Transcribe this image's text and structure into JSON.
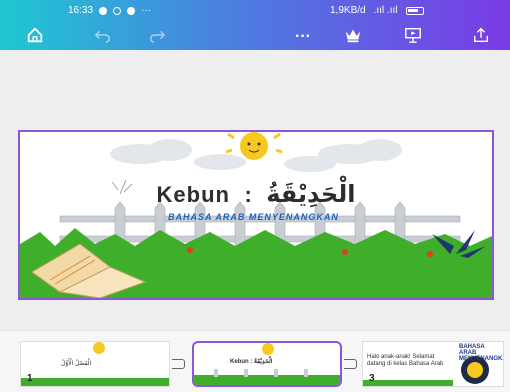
{
  "status_bar": {
    "time": "16:33",
    "speed": "1,9KB/d",
    "carrier": ".ııl .ııl"
  },
  "toolbar": {
    "icons": [
      "home-icon",
      "undo-icon",
      "redo-icon",
      "more-icon",
      "crown-icon",
      "present-icon",
      "share-icon"
    ]
  },
  "slide": {
    "title_latin": "Kebun",
    "separator": ":",
    "title_arabic": "الْحَدِيْقَةُ",
    "banner": "BAHASA ARAB MENYENANGKAN"
  },
  "thumbnails": [
    {
      "number": "1",
      "text": "الْفَصْلُ الْأَوَّلُ"
    },
    {
      "number": "",
      "text": "Kebun : الْحَدِيْقَةُ"
    },
    {
      "number": "3",
      "text": "Halo anak-anak! Selamat datang di kelas Bahasa Arab",
      "badge": "BAHASA ARAB MENYENANGKAN"
    }
  ],
  "colors": {
    "accent": "#8a57d8",
    "header_start": "#1ec8d2",
    "header_end": "#7a3be6"
  }
}
